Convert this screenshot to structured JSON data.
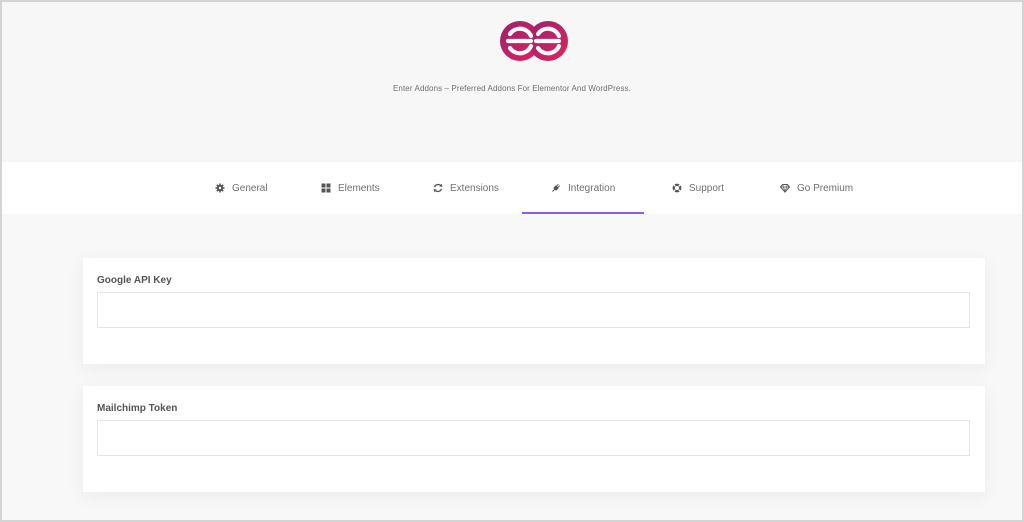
{
  "header": {
    "logo_icon": "enter-addons-logo-icon",
    "tagline": "Enter Addons – Preferred Addons For Elementor And WordPress."
  },
  "tabs": [
    {
      "label": "General",
      "icon": "gear-icon"
    },
    {
      "label": "Elements",
      "icon": "grid-icon"
    },
    {
      "label": "Extensions",
      "icon": "refresh-icon"
    },
    {
      "label": "Integration",
      "icon": "plug-icon",
      "active": true
    },
    {
      "label": "Support",
      "icon": "lifebuoy-icon"
    },
    {
      "label": "Go Premium",
      "icon": "diamond-icon"
    }
  ],
  "fields": {
    "google_api_key": {
      "label": "Google API Key",
      "value": "",
      "placeholder": ""
    },
    "mailchimp_token": {
      "label": "Mailchimp Token",
      "value": "",
      "placeholder": ""
    }
  },
  "colors": {
    "brand": "#c2185b",
    "accent": "#8a5cf6",
    "text_muted": "#707070"
  }
}
